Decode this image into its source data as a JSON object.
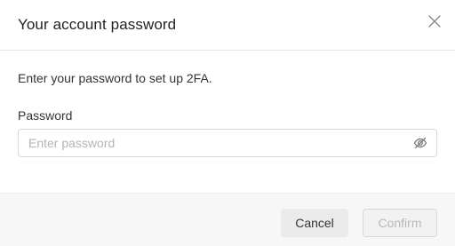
{
  "dialog": {
    "title": "Your account password",
    "close_icon": "close-icon",
    "description": "Enter your password to set up 2FA."
  },
  "password_field": {
    "label": "Password",
    "placeholder": "Enter password",
    "value": "",
    "toggle_icon": "eye-off-icon"
  },
  "footer": {
    "cancel_label": "Cancel",
    "confirm_label": "Confirm",
    "confirm_disabled": true
  }
}
